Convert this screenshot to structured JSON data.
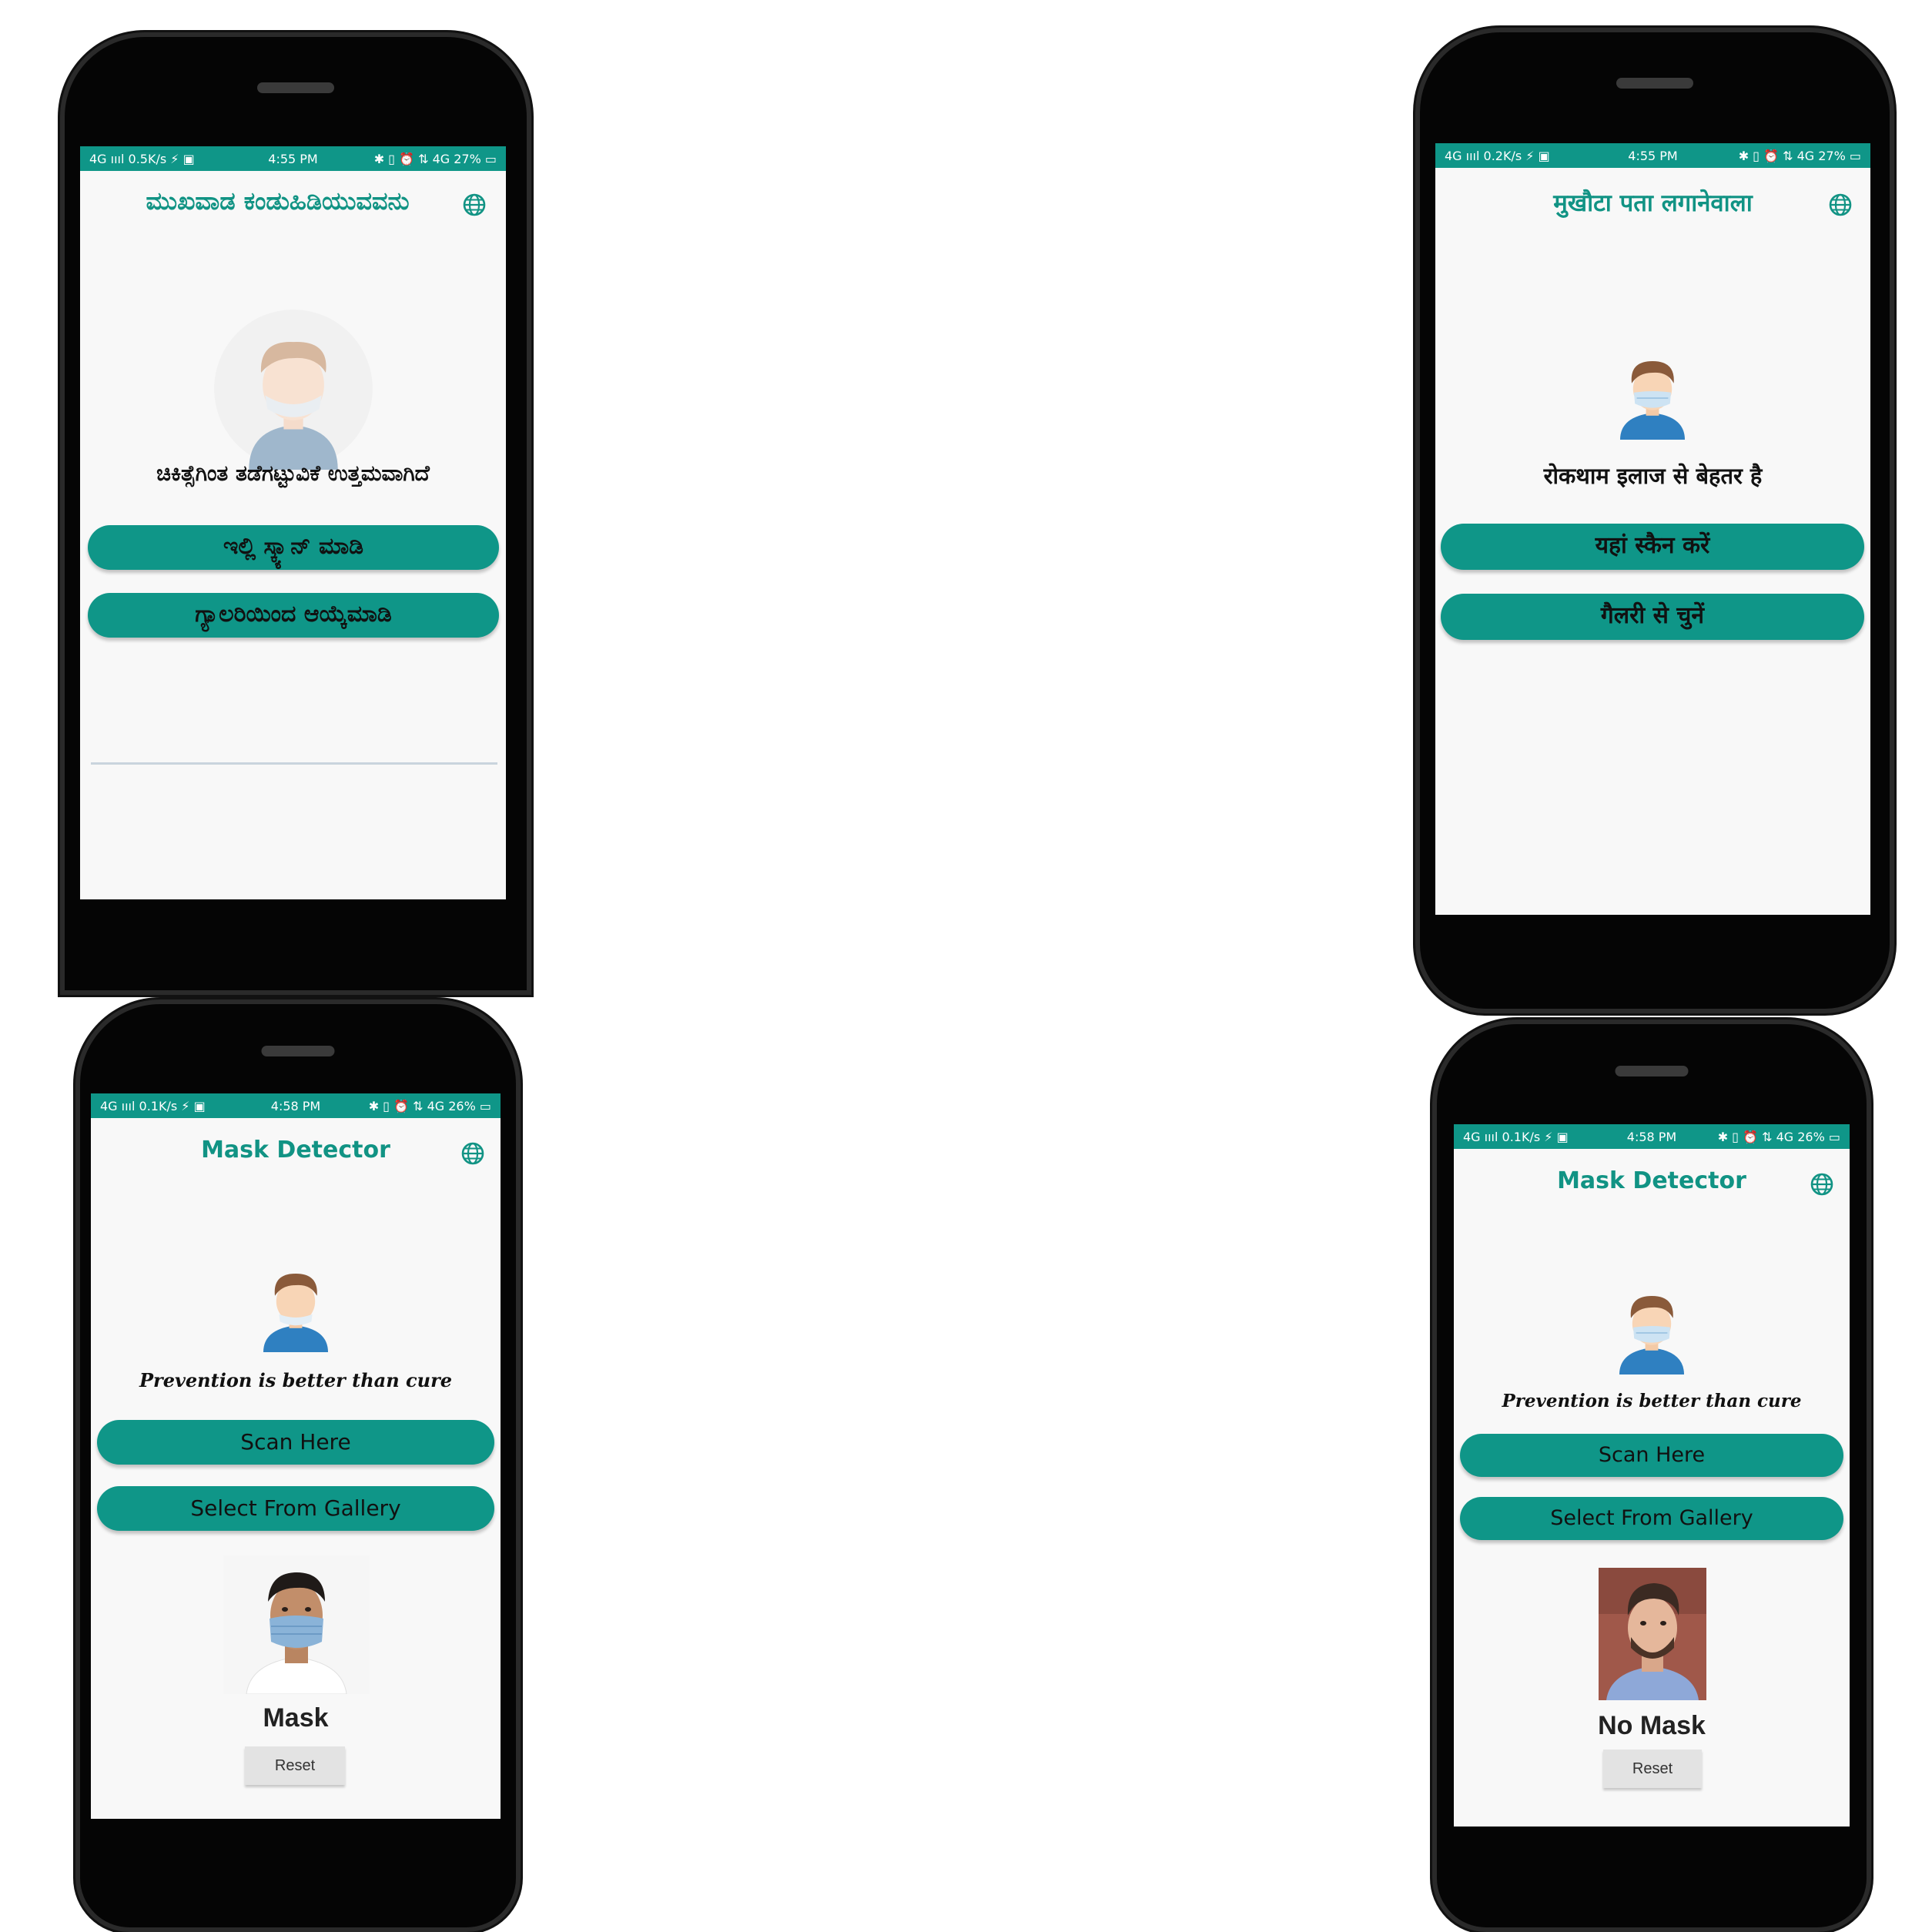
{
  "phones": [
    {
      "status": {
        "left": "4G ıııl 0.5K/s ⚡ ▣",
        "time": "4:55 PM",
        "right": "✱ ▯ ⏰ ⇅ 4G 27% ▭"
      },
      "title": "ಮುಖವಾಡ ಕಂಡುಹಿಡಿಯುವವನು",
      "tagline": "ಚಿಕಿತ್ಸೆಗಿಂತ ತಡೆಗಟ್ಟುವಿಕೆ ಉತ್ತಮವಾಗಿದೆ",
      "scan_label": "ಇಲ್ಲಿ ಸ್ಕ್ಯಾನ್ ಮಾಡಿ",
      "gallery_label": "ಗ್ಯಾಲರಿಯಿಂದ ಆಯ್ಕೆಮಾಡಿ"
    },
    {
      "status": {
        "left": "4G ıııl 0.2K/s ⚡ ▣",
        "time": "4:55 PM",
        "right": "✱ ▯ ⏰ ⇅ 4G 27% ▭"
      },
      "title": "मुखौटा पता लगानेवाला",
      "tagline": "रोकथाम इलाज से बेहतर है",
      "scan_label": "यहां स्कैन करें",
      "gallery_label": "गैलरी से चुनें"
    },
    {
      "status": {
        "left": "4G ıııl 0.1K/s ⚡ ▣",
        "time": "4:58 PM",
        "right": "✱ ▯ ⏰ ⇅ 4G 26% ▭"
      },
      "title": "Mask Detector",
      "tagline": "Prevention is better than cure",
      "scan_label": "Scan Here",
      "gallery_label": "Select From Gallery",
      "result": "Mask",
      "reset_label": "Reset"
    },
    {
      "status": {
        "left": "4G ıııl 0.1K/s ⚡ ▣",
        "time": "4:58 PM",
        "right": "✱ ▯ ⏰ ⇅ 4G 26% ▭"
      },
      "title": "Mask Detector",
      "tagline": "Prevention is better than cure",
      "scan_label": "Scan Here",
      "gallery_label": "Select From Gallery",
      "result": "No Mask",
      "reset_label": "Reset"
    }
  ],
  "colors": {
    "accent": "#0f9688",
    "title": "#119384",
    "phone_body": "#050505"
  },
  "icons": {
    "language": "globe-icon",
    "avatar": "masked-person-icon"
  }
}
